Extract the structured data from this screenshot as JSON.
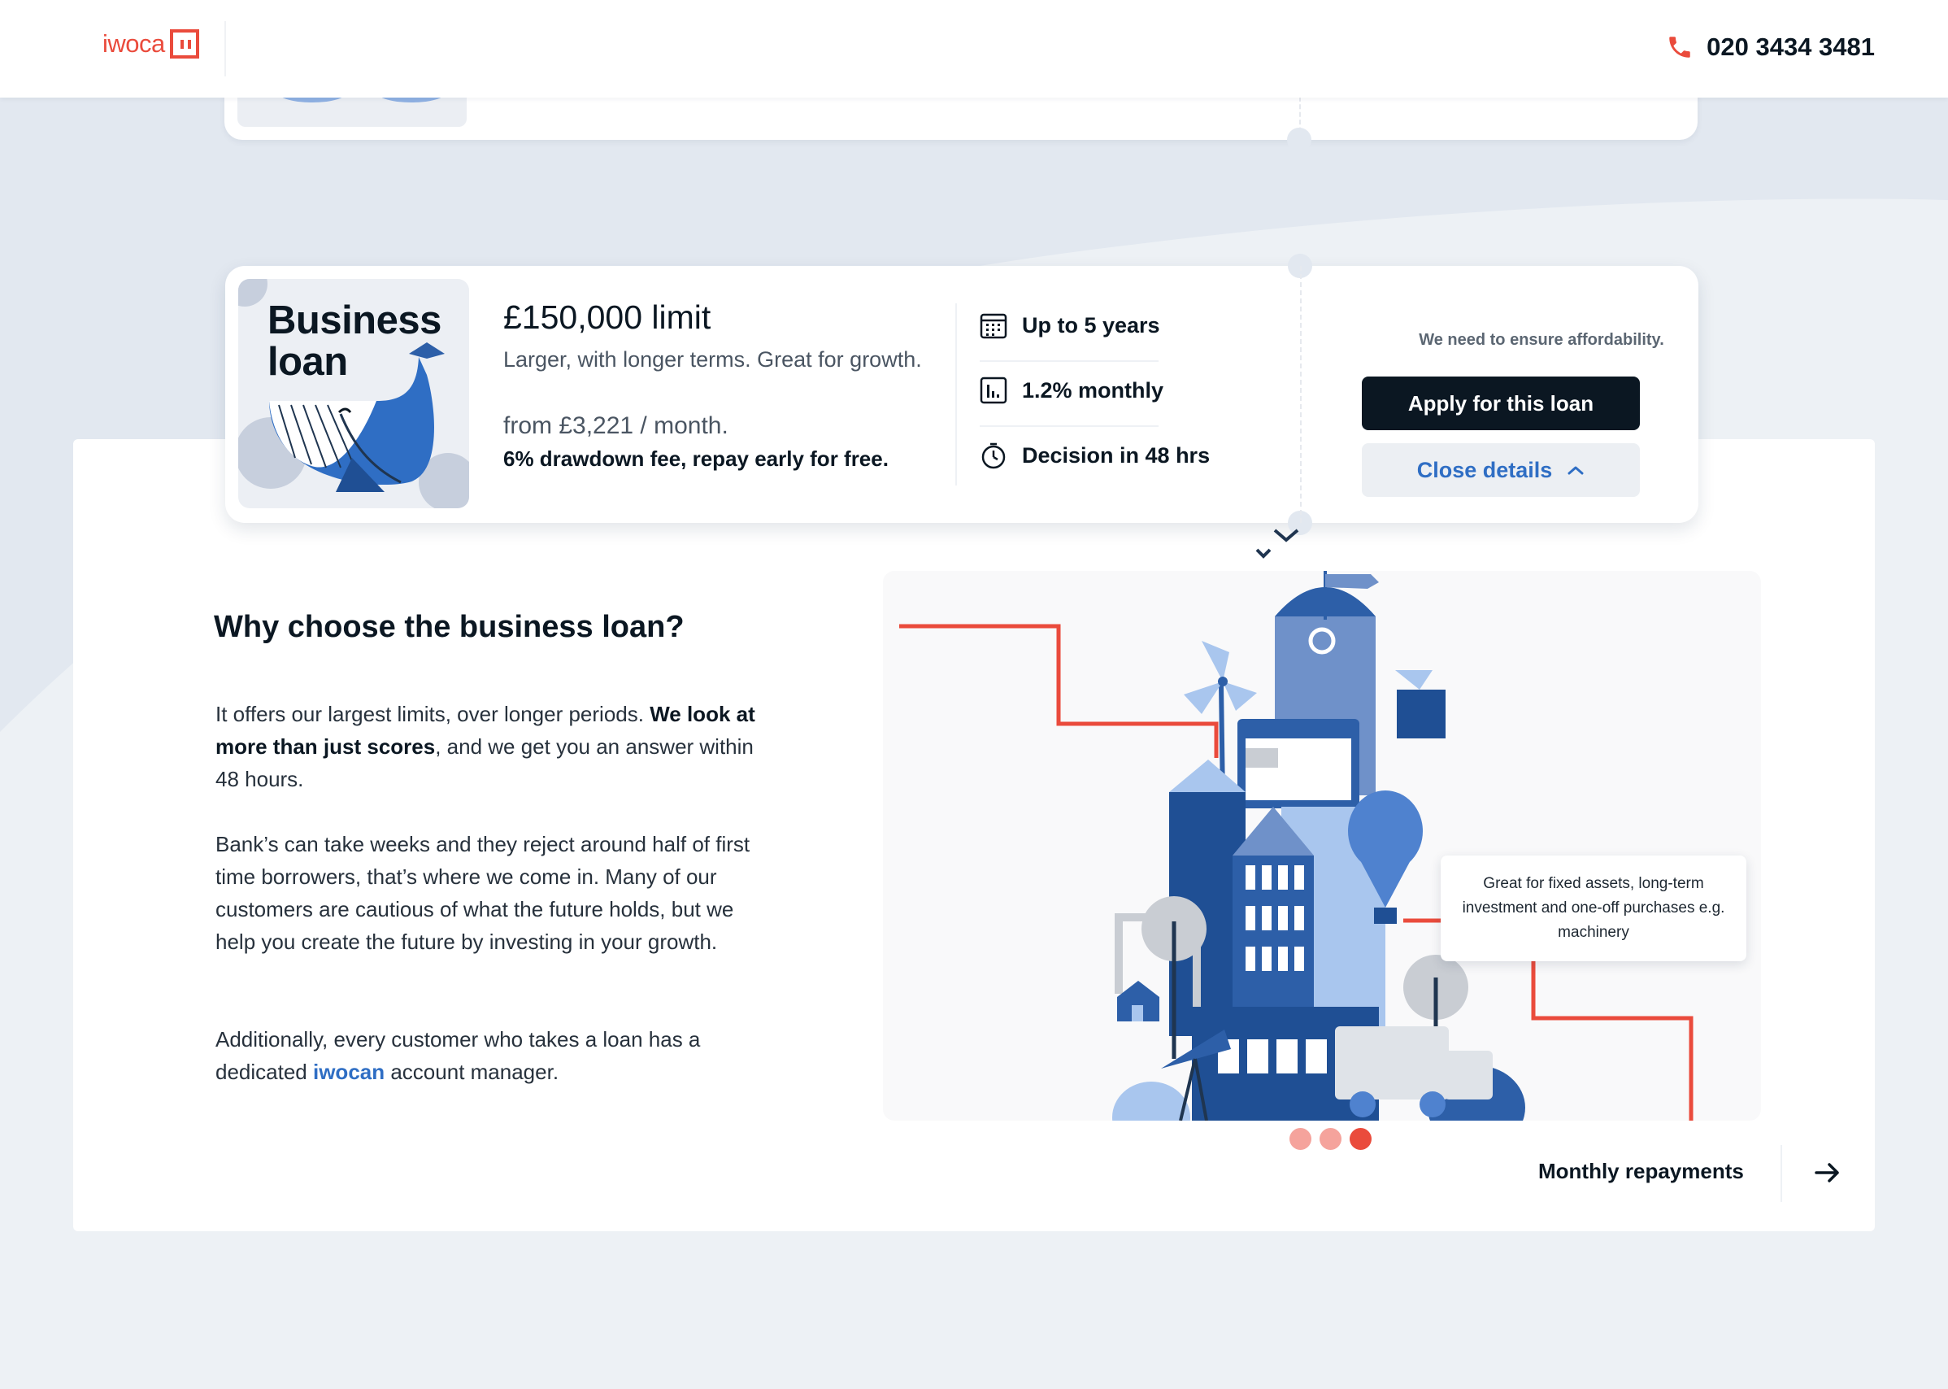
{
  "header": {
    "logo_text": "iwoca",
    "phone_number": "020 3434 3481",
    "phone_icon": "phone-icon"
  },
  "loan_card": {
    "thumbnail_title_line1": "Business",
    "thumbnail_title_line2": "loan",
    "limit": "£150,000 limit",
    "subtitle": "Larger, with longer terms. Great for growth.",
    "from_price": "from £3,221 / month.",
    "fee_text": "6% drawdown fee, repay early for free.",
    "features": [
      {
        "icon": "calendar-icon",
        "label": "Up to 5 years"
      },
      {
        "icon": "chart-icon",
        "label": "1.2% monthly"
      },
      {
        "icon": "stopwatch-icon",
        "label": "Decision in 48 hrs"
      }
    ],
    "affordability_note": "We need to ensure affordability.",
    "apply_label": "Apply for this loan",
    "close_label": "Close details"
  },
  "details": {
    "title": "Why choose the business loan?",
    "para1_a": "It offers our largest limits, over longer periods. ",
    "para1_bold": "We look at more than just scores",
    "para1_b": ", and we get you an answer within 48 hours.",
    "para2": "Bank’s can take weeks and they reject around half of first time borrowers, that’s where we come in. Many of our customers are cautious of what the future holds, but we help you create the future by investing in your growth.",
    "para3_a": "Additionally, every customer who takes a loan has a dedicated ",
    "para3_link": "iwocan",
    "para3_b": " account manager.",
    "tooltip": "Great for fixed assets, long-term investment and one-off purchases e.g. machinery",
    "carousel": {
      "total": 3,
      "active": 3
    },
    "next_label": "Monthly repayments"
  },
  "colors": {
    "brand_red": "#ea4b3c",
    "dark": "#0b1722",
    "link_blue": "#2f6ec4",
    "illustration_blue": "#2d5fa8"
  }
}
